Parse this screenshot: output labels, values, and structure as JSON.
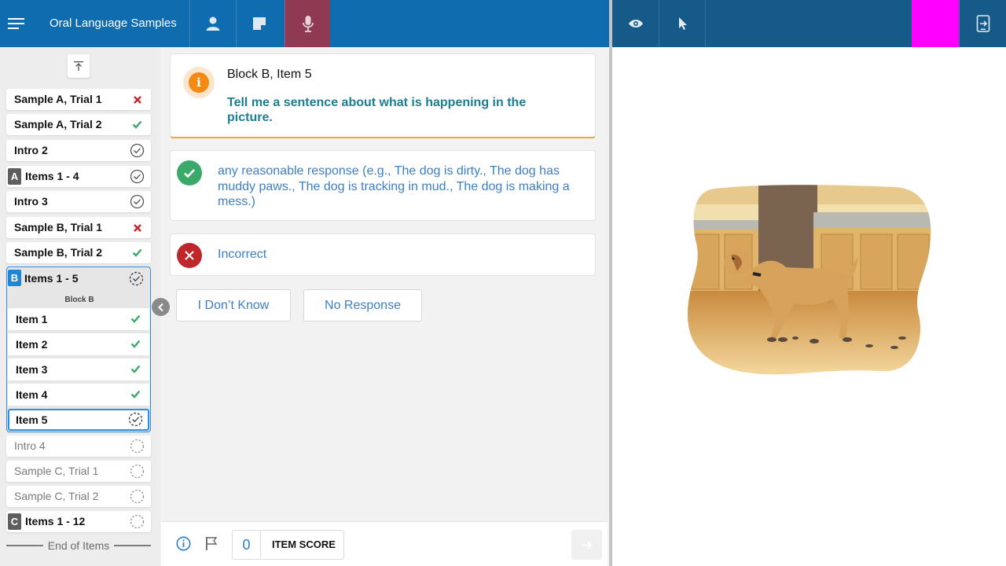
{
  "header": {
    "app_title": "Oral Language Samples"
  },
  "item_list": {
    "rows": [
      {
        "label": "Sample A, Trial 1",
        "status": "incorrect"
      },
      {
        "label": "Sample A, Trial 2",
        "status": "correct"
      },
      {
        "label": "Intro 2",
        "status": "done"
      },
      {
        "badge": "A",
        "label": "Items 1 - 4",
        "status": "done"
      },
      {
        "label": "Intro 3",
        "status": "done"
      },
      {
        "label": "Sample B, Trial 1",
        "status": "incorrect"
      },
      {
        "label": "Sample B, Trial 2",
        "status": "correct"
      }
    ],
    "block_b": {
      "badge": "B",
      "label": "Items 1 - 5",
      "sub_label": "Block B",
      "status": "in-progress",
      "items": [
        {
          "label": "Item 1",
          "status": "correct"
        },
        {
          "label": "Item 2",
          "status": "correct"
        },
        {
          "label": "Item 3",
          "status": "correct"
        },
        {
          "label": "Item 4",
          "status": "correct"
        },
        {
          "label": "Item 5",
          "status": "current"
        }
      ]
    },
    "pending_rows": [
      {
        "label": "Intro 4",
        "status": "pending"
      },
      {
        "label": "Sample C, Trial 1",
        "status": "pending"
      },
      {
        "label": "Sample C, Trial 2",
        "status": "pending"
      }
    ],
    "block_c": {
      "badge": "C",
      "label": "Items 1 - 12",
      "status": "pending"
    },
    "end_label": "End of Items"
  },
  "prompt": {
    "title": "Block B, Item 5",
    "text": "Tell me a sentence about what is happening in the picture."
  },
  "responses": {
    "correct_text": "any reasonable response (e.g., The dog is dirty., The dog has muddy paws., The dog is tracking in mud., The dog is making a mess.)",
    "incorrect_text": "Incorrect",
    "dont_know": "I Don’t Know",
    "no_response": "No Response"
  },
  "footer": {
    "score_value": "0",
    "score_label": "ITEM SCORE"
  },
  "colors": {
    "header_left": "#0f6cae",
    "header_right": "#155a88",
    "active_tab": "#8f3a52",
    "correct_green": "#3aa96a",
    "incorrect_red": "#c0272d",
    "prompt_teal": "#1b7f90",
    "link_blue": "#3c7fc6",
    "accent_orange": "#f38b12",
    "magenta_block": "#ff00ff"
  },
  "icons": {
    "menu": "hamburger-icon",
    "examinee": "person-icon",
    "notes": "note-icon",
    "record": "microphone-icon",
    "view": "eye-icon",
    "pointer": "cursor-icon",
    "switch": "screen-switch-icon"
  }
}
